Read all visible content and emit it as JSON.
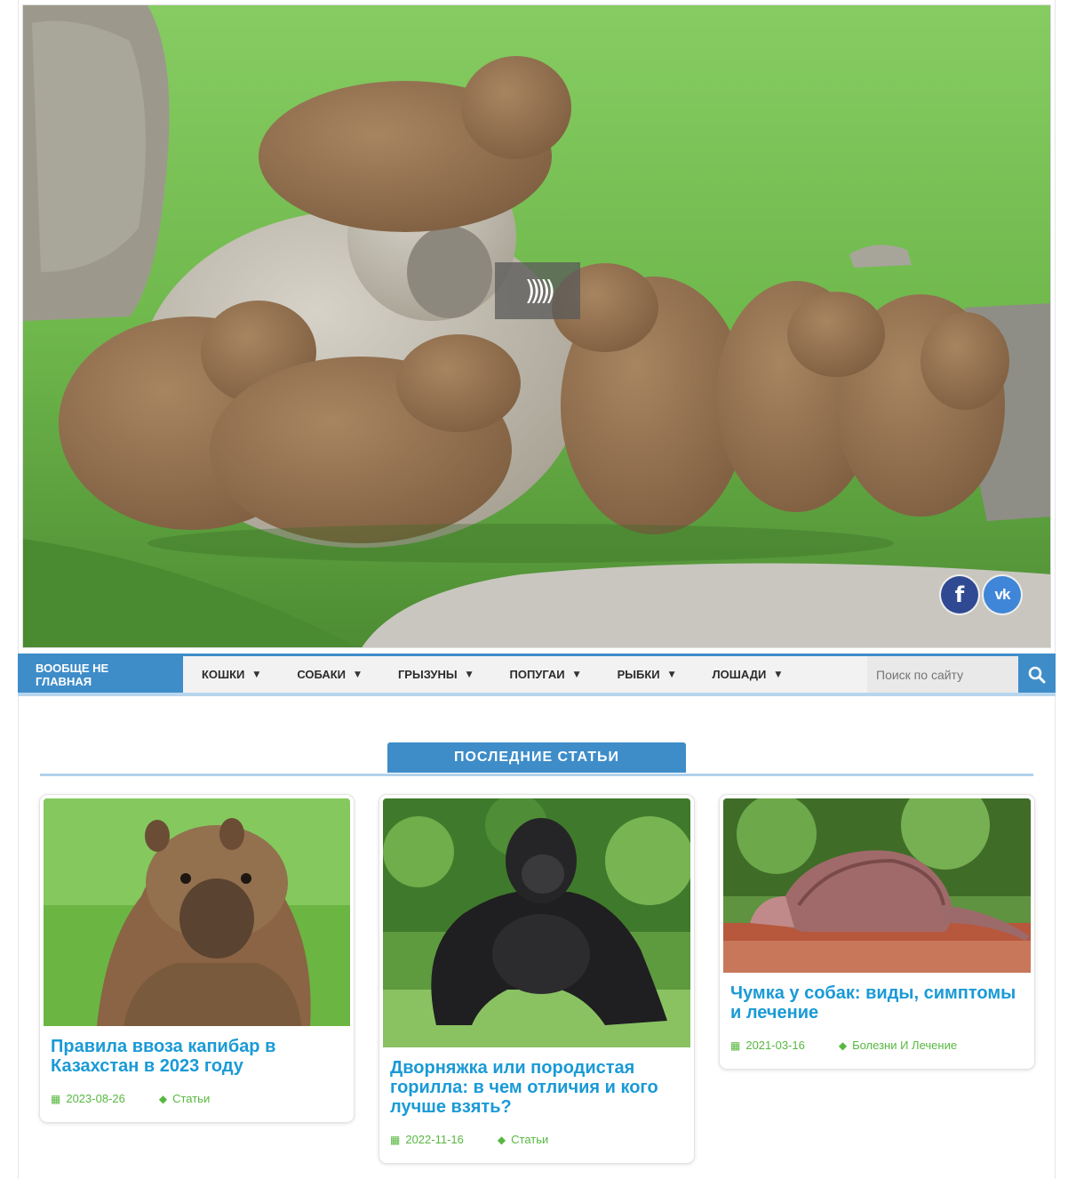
{
  "hero": {
    "play_glyph": ")))))",
    "social": {
      "facebook_glyph": "f",
      "vk_glyph": "vk"
    }
  },
  "nav": {
    "home_label": "Вообще не главная",
    "items": [
      {
        "label": "Кошки"
      },
      {
        "label": "Собаки"
      },
      {
        "label": "Грызуны"
      },
      {
        "label": "Попугаи"
      },
      {
        "label": "Рыбки"
      },
      {
        "label": "Лошади"
      }
    ],
    "search_placeholder": "Поиск по сайту"
  },
  "section": {
    "title": "Последние статьи"
  },
  "cards": [
    {
      "title": "Правила ввоза капибар в Казахстан в 2023 году",
      "date": "2023-08-26",
      "category": "Статьи",
      "image": "capybara-photo"
    },
    {
      "title": "Дворняжка или породистая горилла: в чем отличия и кого лучше взять?",
      "date": "2022-11-16",
      "category": "Статьи",
      "image": "gorilla-photo"
    },
    {
      "title": "Чумка у собак: виды, симптомы и лечение",
      "date": "2021-03-16",
      "category": "Болезни И Лечение",
      "image": "armadillo-photo"
    }
  ],
  "colors": {
    "accent": "#3e8dc9",
    "link": "#1a9ad6",
    "meta": "#57b840",
    "facebook": "#2f4a93",
    "vk": "#3f86d8"
  },
  "icons": {
    "search": "search-icon",
    "caret": "caret-down-icon",
    "calendar": "calendar-icon",
    "tag": "tags-icon"
  }
}
